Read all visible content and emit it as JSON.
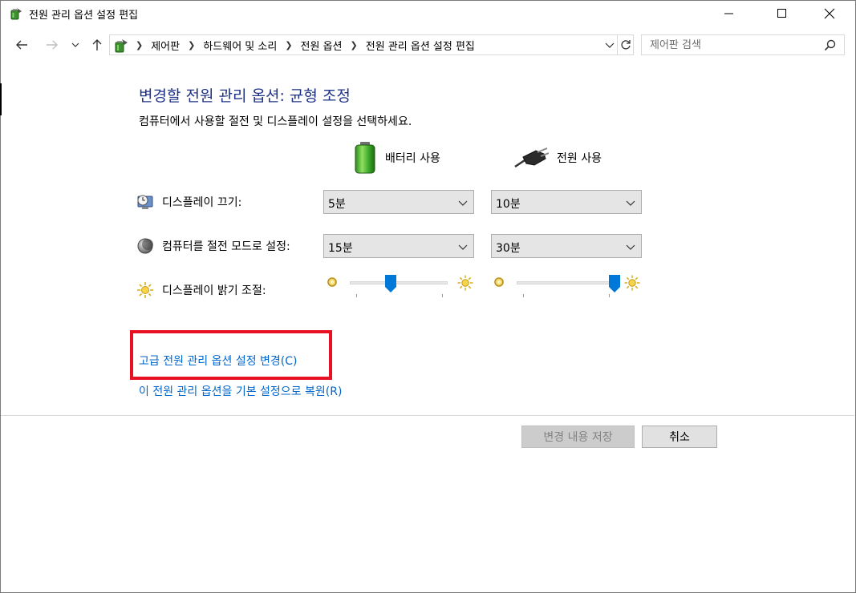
{
  "window": {
    "title": "전원 관리 옵션 설정 편집"
  },
  "address_bar": {
    "crumbs": [
      "제어판",
      "하드웨어 및 소리",
      "전원 옵션",
      "전원 관리 옵션 설정 편집"
    ],
    "search_placeholder": "제어판 검색"
  },
  "content": {
    "heading": "변경할 전원 관리 옵션: 균형 조정",
    "subtitle": "컴퓨터에서 사용할 절전 및 디스플레이 설정을 선택하세요.",
    "columns": {
      "battery": "배터리 사용",
      "plugged": "전원 사용"
    },
    "rows": {
      "display_off": {
        "label": "디스플레이 끄기:",
        "battery_value": "5분",
        "plugged_value": "10분"
      },
      "sleep": {
        "label": "컴퓨터를 절전 모드로 설정:",
        "battery_value": "15분",
        "plugged_value": "30분"
      },
      "brightness": {
        "label": "디스플레이 밝기 조절:",
        "battery_level": 0.42,
        "plugged_level": 1.0
      }
    },
    "links": {
      "advanced": "고급 전원 관리 옵션 설정 변경(C)",
      "restore": "이 전원 관리 옵션을 기본 설정으로 복원(R)"
    },
    "buttons": {
      "save": "변경 내용 저장",
      "cancel": "취소"
    }
  },
  "colors": {
    "heading": "#1e3287",
    "link": "#0066cc",
    "highlight": "#e81123",
    "slider_thumb": "#0078d7"
  }
}
